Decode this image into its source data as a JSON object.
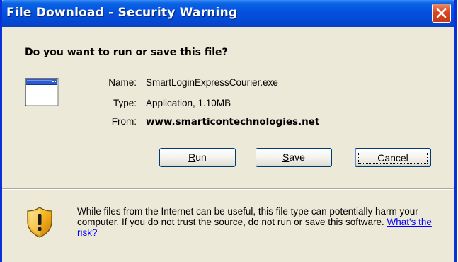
{
  "window": {
    "title": "File Download - Security Warning"
  },
  "dialog": {
    "question": "Do you want to run or save this file?",
    "file": {
      "name_label": "Name:",
      "name_value": "SmartLoginExpressCourier.exe",
      "type_label": "Type:",
      "type_value": "Application, 1.10MB",
      "from_label": "From:",
      "from_value": "www.smarticontechnologies.net"
    },
    "buttons": {
      "run": {
        "mnemonic": "R",
        "rest": "un"
      },
      "save": {
        "mnemonic": "S",
        "rest": "ave"
      },
      "cancel": "Cancel"
    },
    "warning": {
      "text": "While files from the Internet can be useful, this file type can potentially harm your computer. If you do not trust the source, do not run or save this software. ",
      "link": "What's the risk?"
    }
  },
  "icons": {
    "app": "application-window-icon",
    "shield": "security-shield-warning-icon",
    "close": "close-icon"
  },
  "colors": {
    "titlebar": "#0553e0",
    "close_button": "#d9481f",
    "dialog_background": "#ece9d8",
    "link": "#0000ff"
  }
}
